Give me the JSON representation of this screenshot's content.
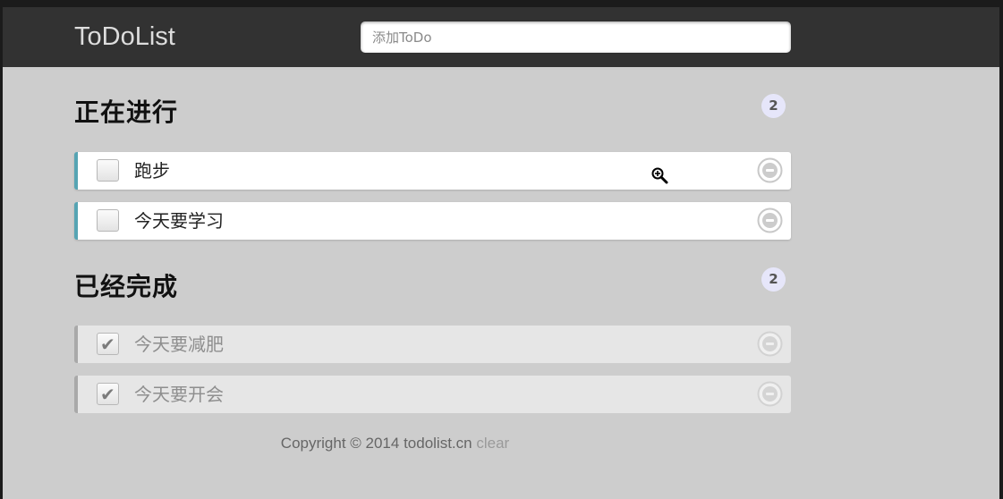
{
  "header": {
    "logo": "ToDoList",
    "input_placeholder": "添加ToDo"
  },
  "in_progress": {
    "title": "正在进行",
    "count": "2",
    "items": [
      {
        "label": "跑步",
        "done": false
      },
      {
        "label": "今天要学习",
        "done": false
      }
    ]
  },
  "completed": {
    "title": "已经完成",
    "count": "2",
    "items": [
      {
        "label": "今天要减肥",
        "done": true
      },
      {
        "label": "今天要开会",
        "done": true
      }
    ]
  },
  "footer": {
    "copyright": "Copyright © 2014 todolist.cn",
    "clear_label": "clear"
  },
  "icons": {
    "remove": "minus-circle-icon",
    "check": "check-icon",
    "cursor": "zoom-in-cursor-icon"
  },
  "colors": {
    "header_bg": "#323232",
    "page_bg": "#cdcdcd",
    "active_accent": "#56a4b3",
    "done_accent": "#a9a9a9",
    "count_badge_bg": "#e6e6fa"
  }
}
